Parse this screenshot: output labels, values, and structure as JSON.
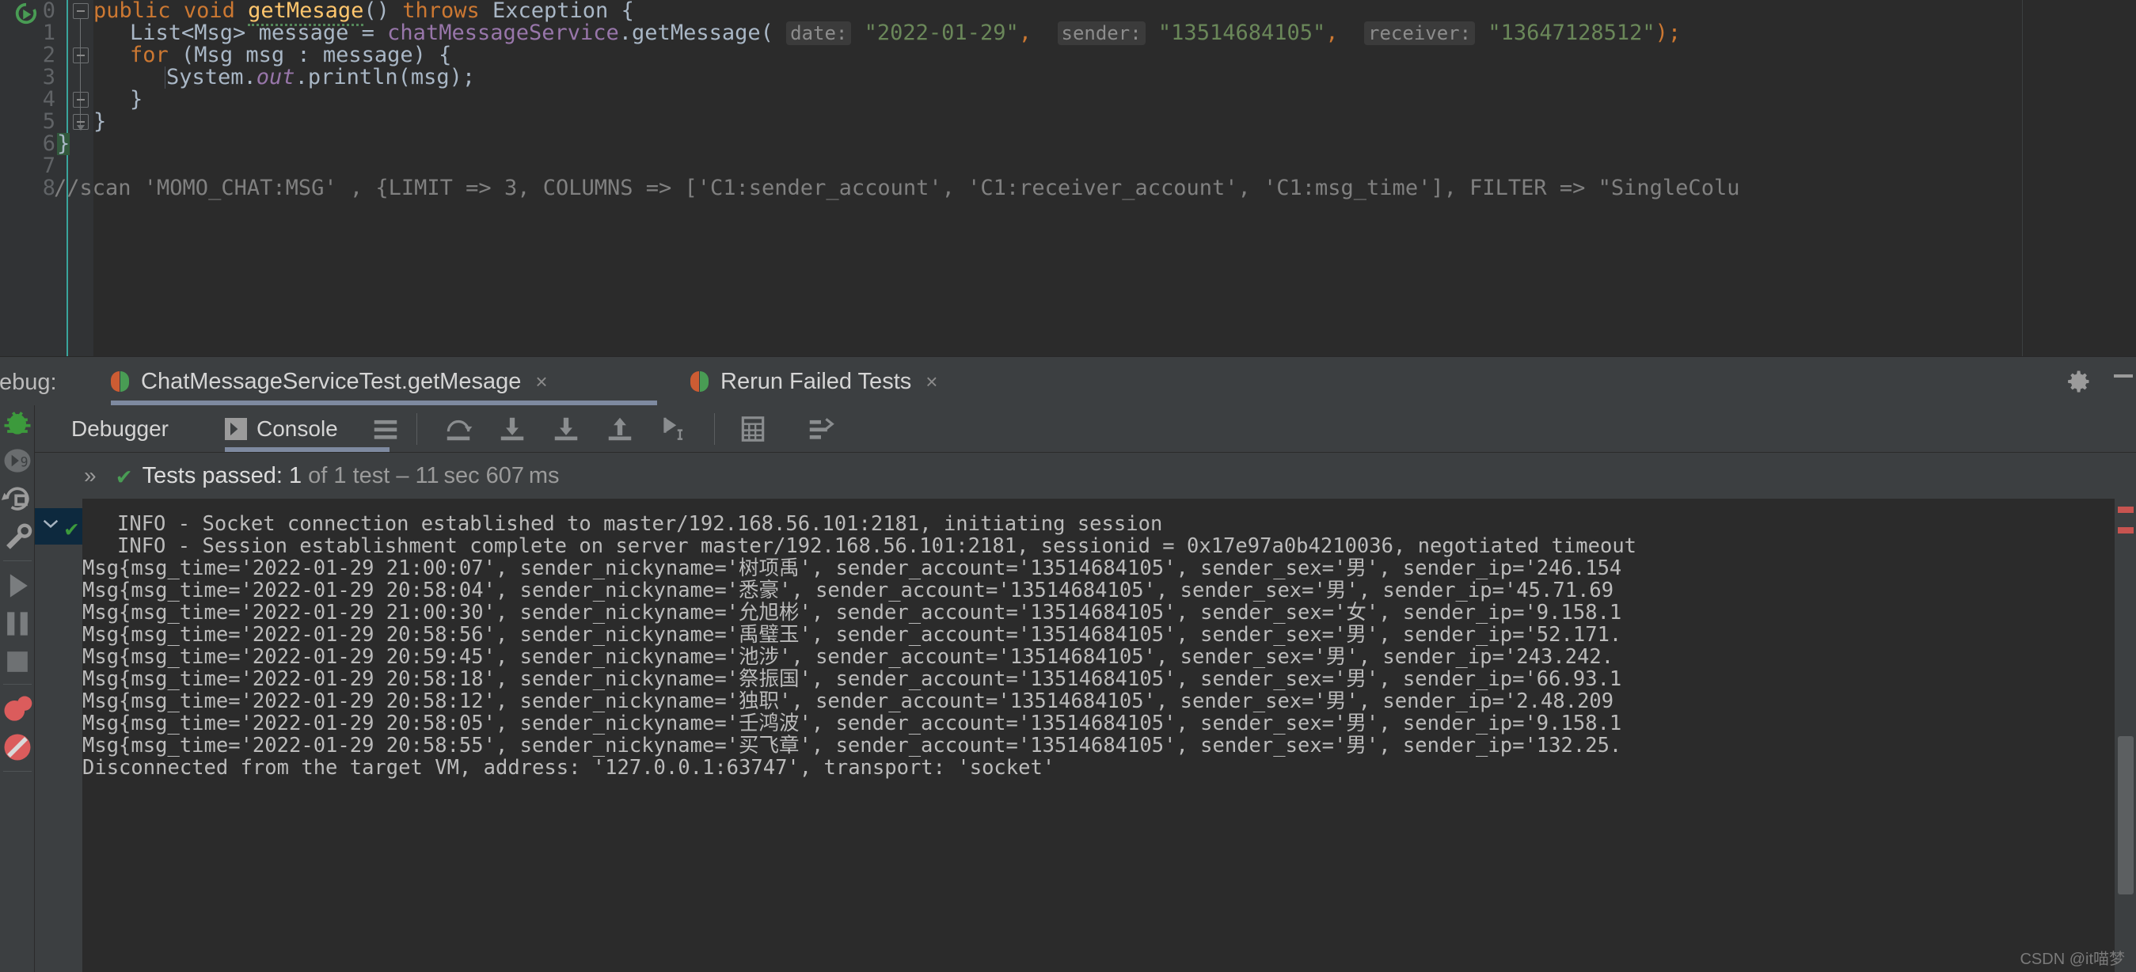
{
  "editor": {
    "line_numbers": [
      "0",
      "1",
      "2",
      "3",
      "4",
      "5",
      "6",
      "7",
      "8"
    ],
    "run_icon": "run-test-gutter-icon",
    "code": {
      "l0": {
        "kw_public": "public",
        "kw_void": "void",
        "method_name": "getMesage",
        "parens": "()",
        "kw_throws": "throws",
        "exception": "Exception",
        "brace": "{"
      },
      "l1": {
        "type": "List<Msg>",
        "var": "message",
        "eq": "=",
        "service": "chatMessageService",
        "dot": ".",
        "call": "getMessage(",
        "hint_date": "date:",
        "arg_date": "\"2022-01-29\"",
        "comma1": ",",
        "hint_sender": "sender:",
        "arg_sender": "\"13514684105\"",
        "comma2": ",",
        "hint_receiver": "receiver:",
        "arg_receiver": "\"13647128512\"",
        "tail": ");"
      },
      "l2": {
        "kw_for": "for",
        "rest": "(Msg msg : message) {"
      },
      "l3": {
        "sys": "System.",
        "out": "out",
        "rest": ".println(msg);"
      },
      "l4": {
        "brace": "}"
      },
      "l5": {
        "brace": "}"
      },
      "l6": {
        "brace": "}"
      },
      "l8": {
        "comment": "//scan 'MOMO_CHAT:MSG' , {LIMIT => 3, COLUMNS => ['C1:sender_account', 'C1:receiver_account', 'C1:msg_time'], FILTER => \"SingleColu"
      }
    }
  },
  "debug": {
    "label": "Debug:",
    "tabs": [
      {
        "title": "ChatMessageServiceTest.getMesage",
        "close": "×",
        "icon": "run-config-icon",
        "active": true
      },
      {
        "title": "Rerun Failed Tests",
        "close": "×",
        "icon": "run-config-icon",
        "active": false
      }
    ],
    "settings_icon": "gear-icon",
    "minimize_icon": "minimize-icon",
    "subtabs": [
      {
        "label": "Debugger",
        "active": false
      },
      {
        "label": "Console",
        "active": true,
        "icon": "console-icon"
      }
    ],
    "toolbar_icons": [
      "soft-wrap-icon",
      "step-over-icon",
      "step-into-icon",
      "force-step-into-icon",
      "step-out-icon",
      "run-to-cursor-icon",
      "evaluate-expression-icon",
      "thread-dump-icon"
    ],
    "rail_icons": [
      "debug-bug-icon",
      "mute-breakpoints-icon",
      "restore-layout-icon",
      "settings-wrench-icon",
      "resume-program-icon",
      "pause-program-icon",
      "stop-icon",
      "view-breakpoints-icon",
      "mute-all-breakpoints-icon"
    ],
    "test_status": {
      "chevrons": "»",
      "check": "✔",
      "main": "Tests passed: 1",
      "detail": "of 1 test – 11 sec 607 ms"
    }
  },
  "console": {
    "fold_chevron": "chevron-down-icon",
    "fold_check": "✔",
    "lines": [
      "INFO - Socket connection established to master/192.168.56.101:2181, initiating session",
      "INFO - Session establishment complete on server master/192.168.56.101:2181, sessionid = 0x17e97a0b4210036, negotiated timeout",
      "Msg{msg_time='2022-01-29 21:00:07', sender_nickyname='树项禹', sender_account='13514684105', sender_sex='男', sender_ip='246.154",
      "Msg{msg_time='2022-01-29 20:58:04', sender_nickyname='悉豪', sender_account='13514684105', sender_sex='男', sender_ip='45.71.69",
      "Msg{msg_time='2022-01-29 21:00:30', sender_nickyname='允旭彬', sender_account='13514684105', sender_sex='女', sender_ip='9.158.1",
      "Msg{msg_time='2022-01-29 20:58:56', sender_nickyname='禹璧玉', sender_account='13514684105', sender_sex='男', sender_ip='52.171.",
      "Msg{msg_time='2022-01-29 20:59:45', sender_nickyname='池涉', sender_account='13514684105', sender_sex='男', sender_ip='243.242.",
      "Msg{msg_time='2022-01-29 20:58:18', sender_nickyname='祭振国', sender_account='13514684105', sender_sex='男', sender_ip='66.93.1",
      "Msg{msg_time='2022-01-29 20:58:12', sender_nickyname='独职', sender_account='13514684105', sender_sex='男', sender_ip='2.48.209",
      "Msg{msg_time='2022-01-29 20:58:05', sender_nickyname='壬鸿波', sender_account='13514684105', sender_sex='男', sender_ip='9.158.1",
      "Msg{msg_time='2022-01-29 20:58:55', sender_nickyname='买飞章', sender_account='13514684105', sender_sex='男', sender_ip='132.25.",
      "Disconnected from the target VM, address: '127.0.0.1:63747', transport: 'socket'"
    ]
  },
  "watermark": "CSDN @it喵梦",
  "colors": {
    "editor_bg": "#2b2b2b",
    "panel_bg": "#3c3f41",
    "gutter_bg": "#313335",
    "accent_green": "#499c54",
    "accent_orange": "#cc7832",
    "string_green": "#6a8759",
    "method_yellow": "#ffc66d",
    "field_purple": "#9876aa",
    "text_grey": "#a9b7c6",
    "tab_underline": "#7e8aa0",
    "fold_highlight": "#0d293e"
  }
}
